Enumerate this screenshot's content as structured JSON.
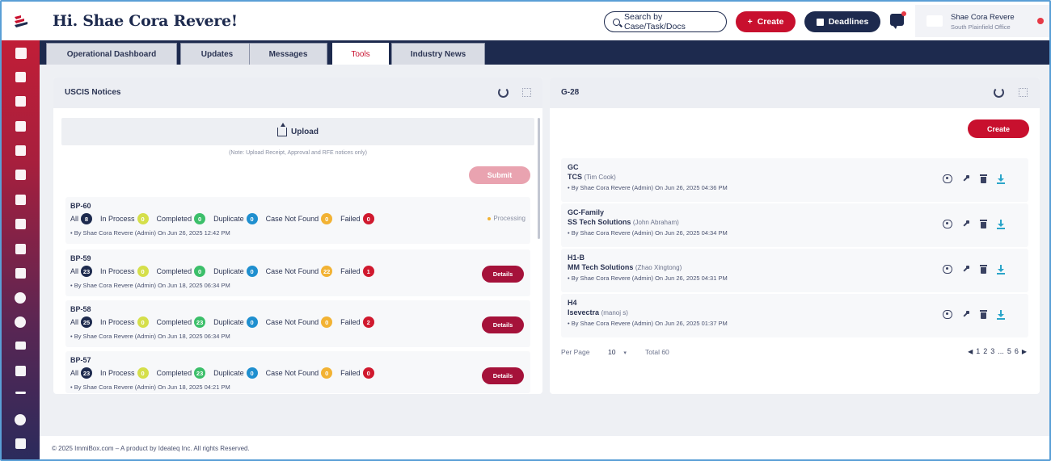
{
  "header": {
    "greeting": "Hi. Shae Cora Revere!",
    "search_label": "Search by Case/Task/Docs",
    "create_label": "Create",
    "deadlines_label": "Deadlines",
    "user_name": "Shae Cora Revere",
    "user_office": "South Plainfield Office"
  },
  "tabs": [
    {
      "label": "Operational Dashboard",
      "active": false
    },
    {
      "label": "Updates",
      "active": false
    },
    {
      "label": "Messages",
      "active": false
    },
    {
      "label": "Tools",
      "active": true
    },
    {
      "label": "Industry News",
      "active": false
    }
  ],
  "uscis": {
    "title": "USCIS Notices",
    "upload_label": "Upload",
    "upload_note": "(Note: Upload Receipt, Approval and RFE notices only)",
    "submit_label": "Submit",
    "stat_labels": {
      "all": "All",
      "in_process": "In Process",
      "completed": "Completed",
      "duplicate": "Duplicate",
      "case_not_found": "Case Not Found",
      "failed": "Failed"
    },
    "processing_label": "Processing",
    "details_label": "Details",
    "notices": [
      {
        "id": "BP-60",
        "all": "8",
        "in_process": "0",
        "completed": "0",
        "duplicate": "0",
        "case_not_found": "0",
        "failed": "0",
        "by": "• By Shae Cora Revere (Admin) On Jun 26, 2025 12:42 PM",
        "status": "processing"
      },
      {
        "id": "BP-59",
        "all": "23",
        "in_process": "0",
        "completed": "0",
        "duplicate": "0",
        "case_not_found": "22",
        "failed": "1",
        "by": "• By Shae Cora Revere (Admin) On Jun 18, 2025 06:34 PM",
        "status": "details"
      },
      {
        "id": "BP-58",
        "all": "25",
        "in_process": "0",
        "completed": "23",
        "duplicate": "0",
        "case_not_found": "0",
        "failed": "2",
        "by": "• By Shae Cora Revere (Admin) On Jun 18, 2025 06:34 PM",
        "status": "details"
      },
      {
        "id": "BP-57",
        "all": "23",
        "in_process": "0",
        "completed": "23",
        "duplicate": "0",
        "case_not_found": "0",
        "failed": "0",
        "by": "• By Shae Cora Revere (Admin) On Jun 18, 2025 04:21 PM",
        "status": "details"
      }
    ]
  },
  "g28": {
    "title": "G-28",
    "create_label": "Create",
    "items": [
      {
        "type": "GC",
        "client": "TCS",
        "contact": "(Tim Cook)",
        "by": "• By Shae Cora Revere (Admin) On Jun 26, 2025 04:36 PM"
      },
      {
        "type": "GC-Family",
        "client": "SS Tech Solutions",
        "contact": "(John Abraham)",
        "by": "• By Shae Cora Revere (Admin) On Jun 26, 2025 04:34 PM"
      },
      {
        "type": "H1-B",
        "client": "MM Tech Solutions",
        "contact": "(Zhao Xingtong)",
        "by": "• By Shae Cora Revere (Admin) On Jun 26, 2025 04:31 PM"
      },
      {
        "type": "H4",
        "client": "Isevectra",
        "contact": "(manoj s)",
        "by": "• By Shae Cora Revere (Admin) On Jun 26, 2025 01:37 PM"
      }
    ],
    "pager": {
      "per_page_label": "Per Page",
      "per_page_value": "10",
      "total_label": "Total 60",
      "pages": [
        "1",
        "2",
        "3",
        "...",
        "5",
        "6"
      ]
    }
  },
  "footer": {
    "text": "© 2025 ImmiBox.com – A product by Ideateq Inc. All rights Reserved."
  },
  "colors": {
    "brand_red": "#c8102e",
    "navy": "#1d2a4e"
  }
}
